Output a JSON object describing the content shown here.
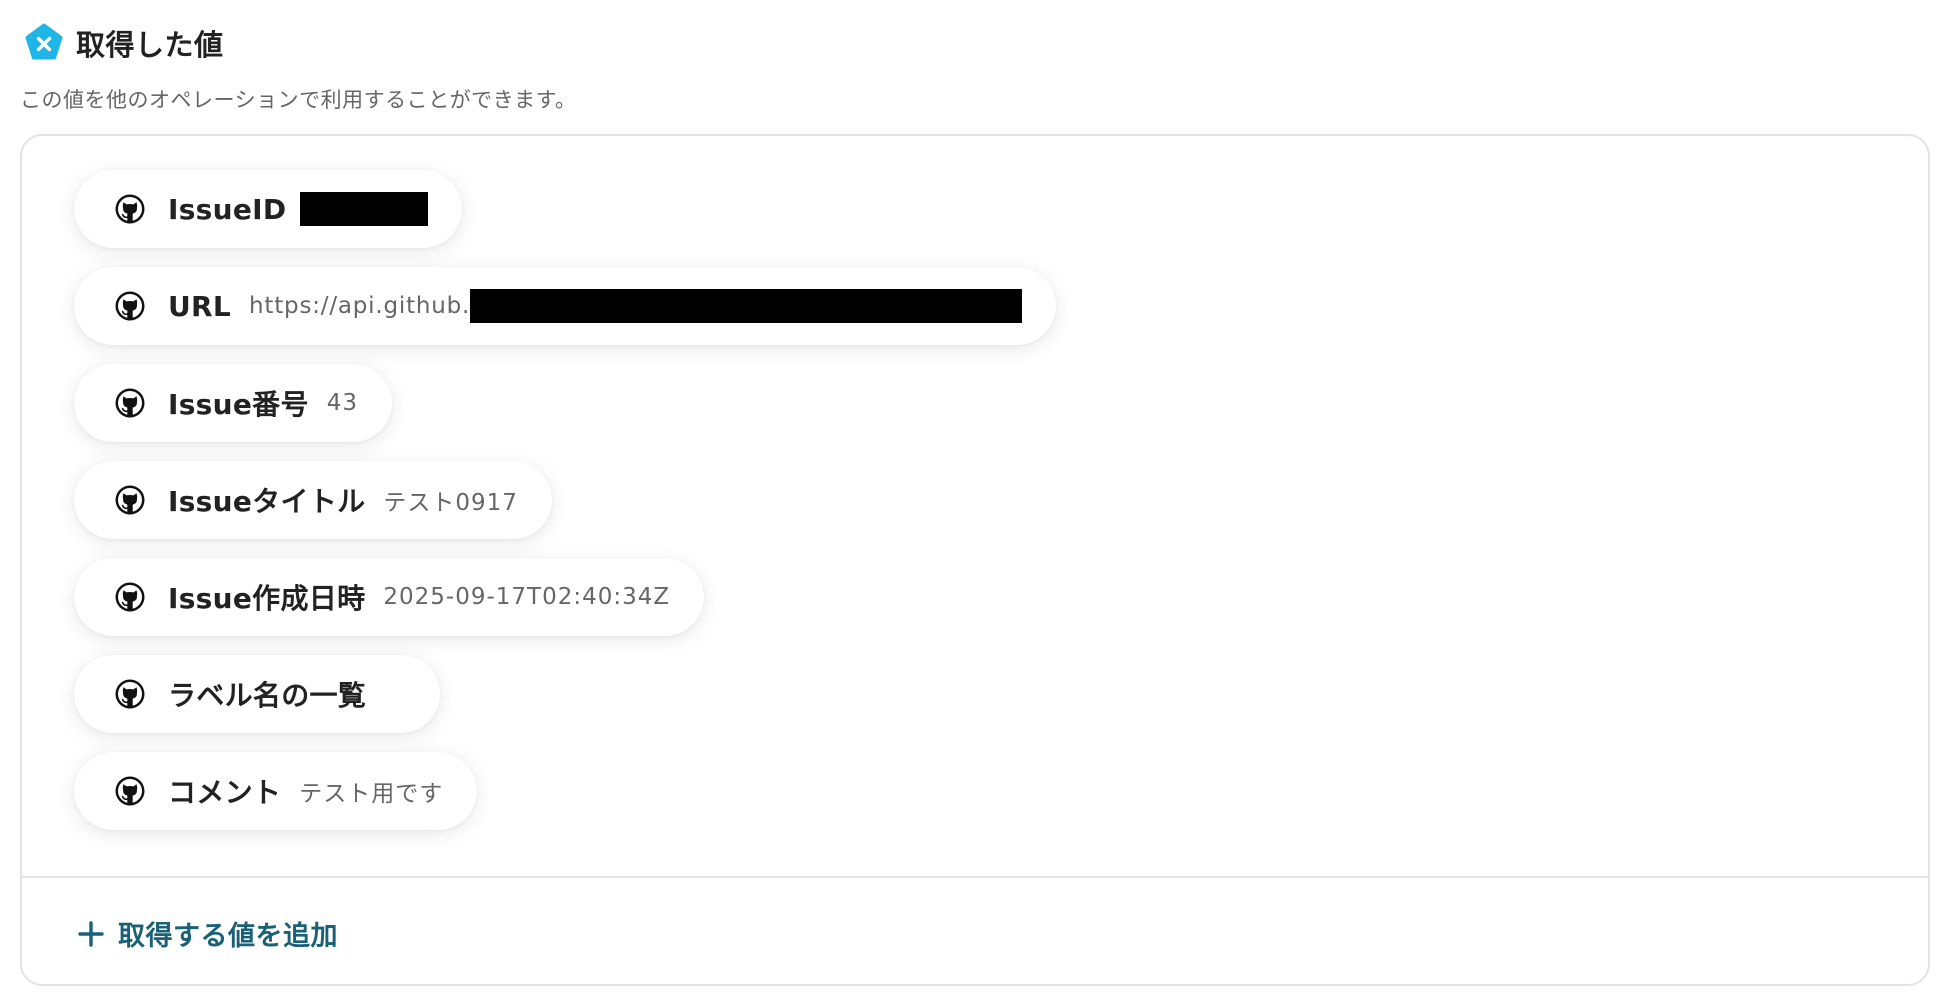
{
  "header": {
    "title": "取得した値",
    "icon": "yoom-logo-icon",
    "accent_color": "#1fb5e6"
  },
  "description": "この値を他のオペレーションで利用することができます。",
  "items": [
    {
      "label": "IssueID",
      "value": "",
      "redacted": true,
      "icon": "github-icon"
    },
    {
      "label": "URL",
      "value": "https://api.github.",
      "redacted": true,
      "icon": "github-icon"
    },
    {
      "label": "Issue番号",
      "value": "43",
      "redacted": false,
      "icon": "github-icon"
    },
    {
      "label": "Issueタイトル",
      "value": "テスト0917",
      "redacted": false,
      "icon": "github-icon"
    },
    {
      "label": "Issue作成日時",
      "value": "2025-09-17T02:40:34Z",
      "redacted": false,
      "icon": "github-icon"
    },
    {
      "label": "ラベル名の一覧",
      "value": "",
      "redacted": false,
      "icon": "github-icon"
    },
    {
      "label": "コメント",
      "value": "テスト用です",
      "redacted": false,
      "icon": "github-icon"
    }
  ],
  "add_button": {
    "label": "取得する値を追加",
    "icon": "plus-icon",
    "color": "#1a6077"
  }
}
